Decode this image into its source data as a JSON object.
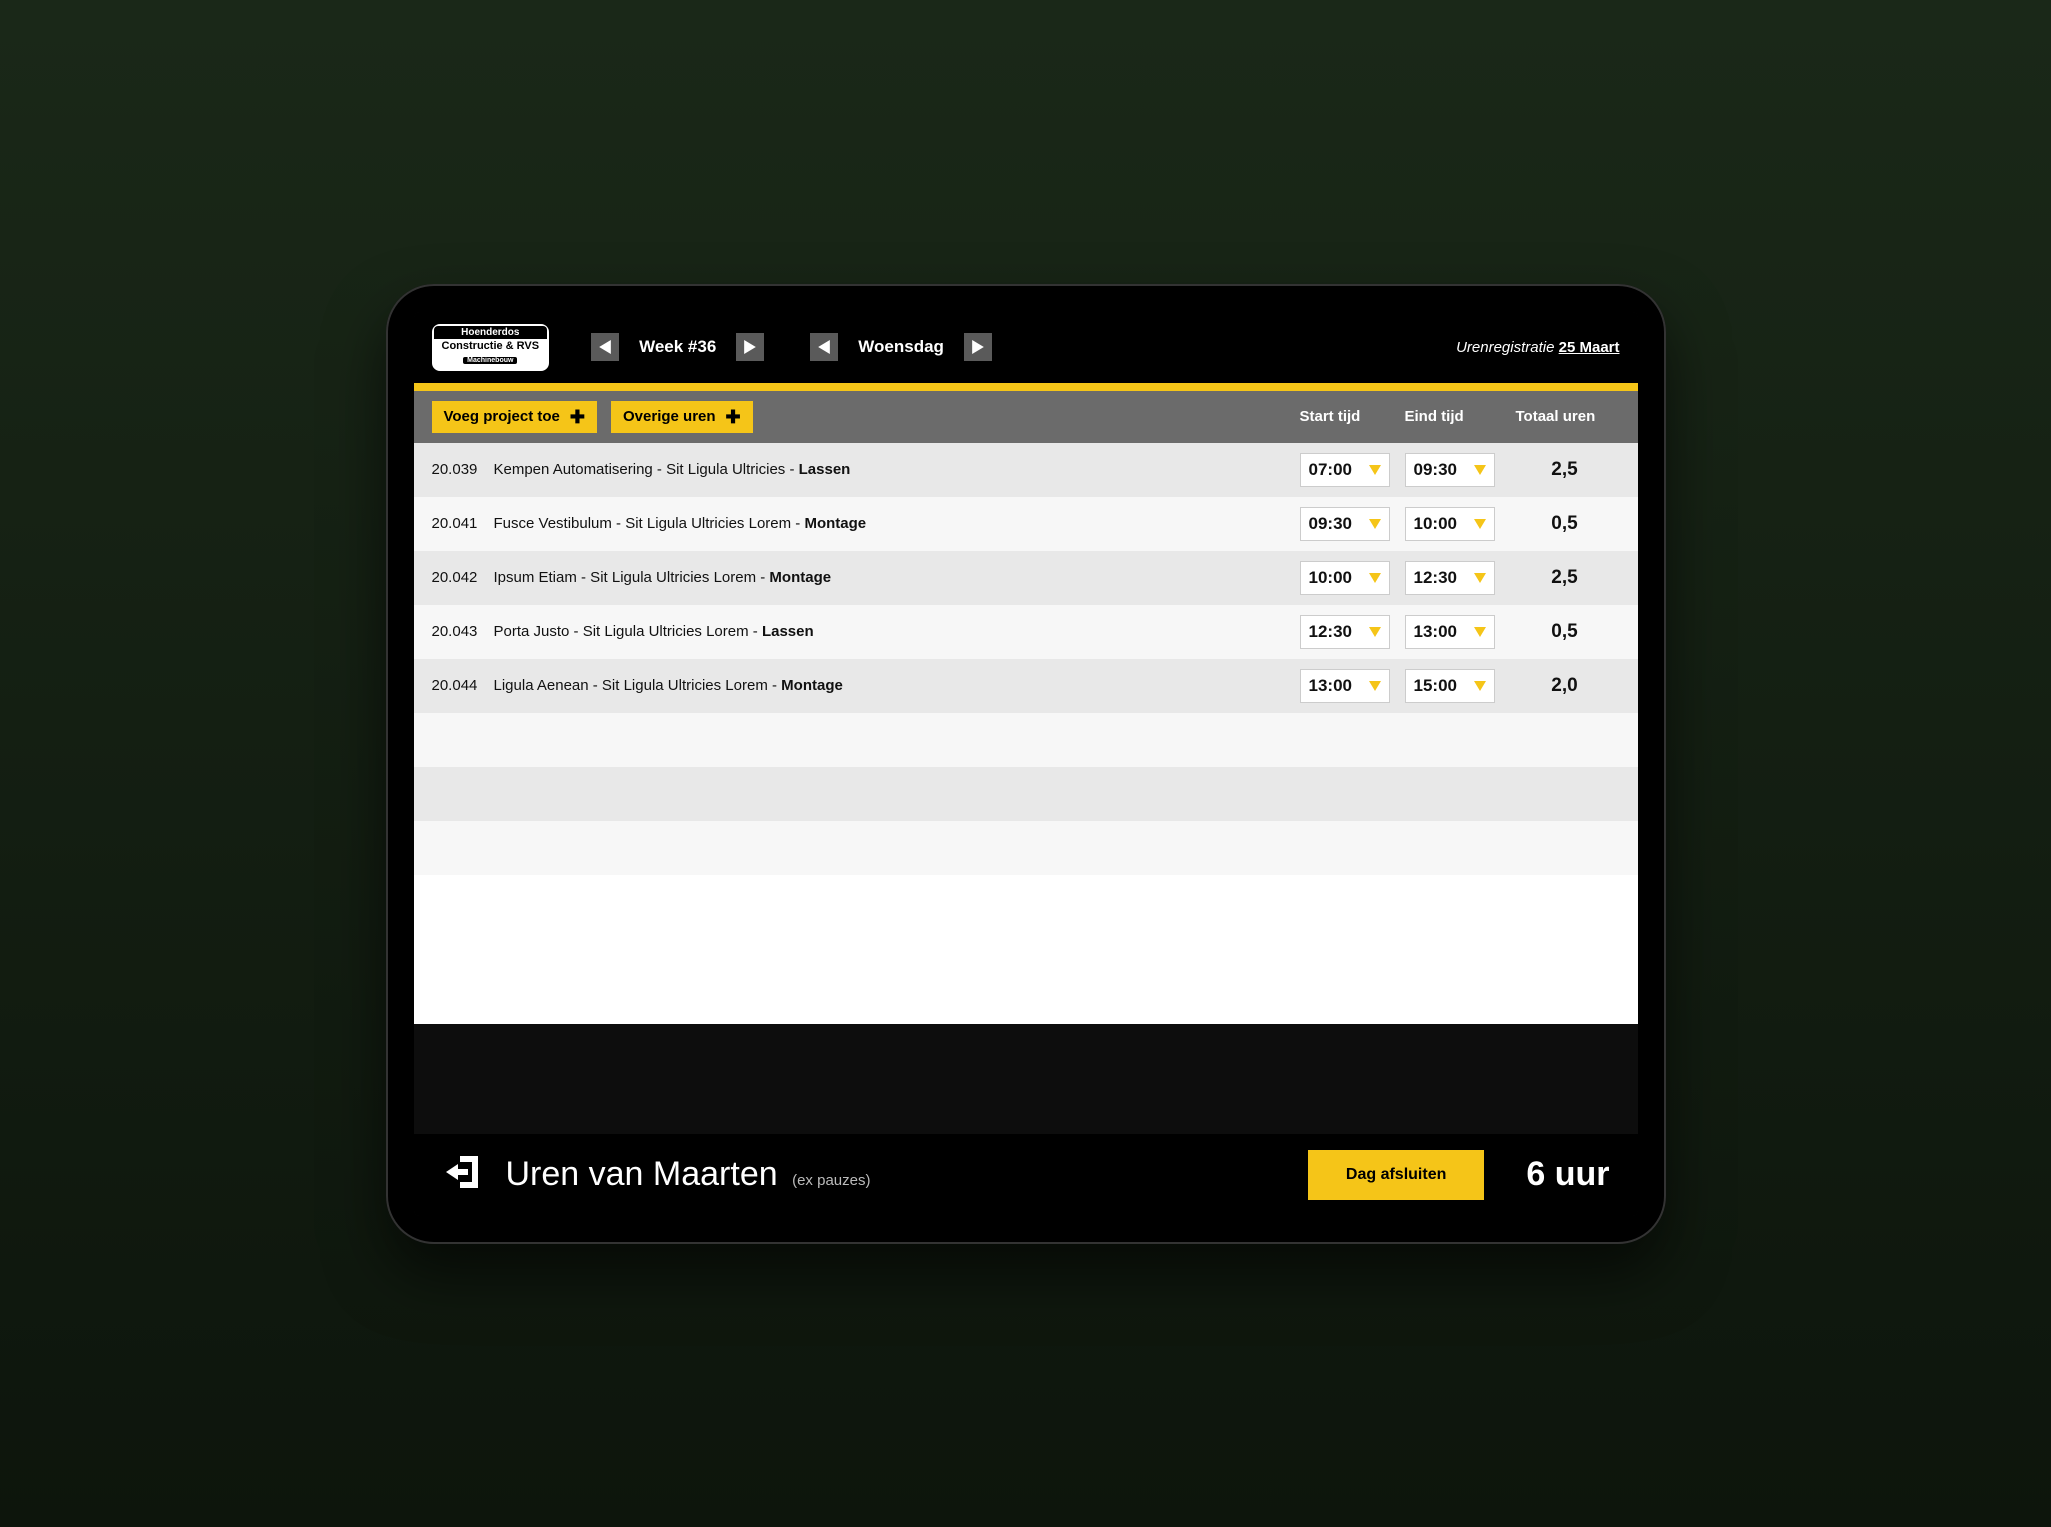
{
  "logo": {
    "line1": "Hoenderdos",
    "line2": "Constructie & RVS",
    "line3": "Machinebouw"
  },
  "header": {
    "week_label": "Week #36",
    "day_label": "Woensdag",
    "right_prefix": "Urenregistratie ",
    "right_date": "25 Maart"
  },
  "toolbar": {
    "add_project": "Voeg project toe",
    "other_hours": "Overige uren",
    "col_start": "Start tijd",
    "col_end": "Eind tijd",
    "col_total": "Totaal uren"
  },
  "rows": [
    {
      "code": "20.039",
      "client": "Kempen Automatisering",
      "desc": "Sit Ligula Ultricies ",
      "task": "Lassen",
      "start": "07:00",
      "end": "09:30",
      "total": "2,5"
    },
    {
      "code": "20.041",
      "client": "Fusce Vestibulum",
      "desc": "Sit Ligula Ultricies Lorem",
      "task": "Montage",
      "start": "09:30",
      "end": "10:00",
      "total": "0,5"
    },
    {
      "code": "20.042",
      "client": "Ipsum Etiam",
      "desc": "Sit Ligula Ultricies Lorem",
      "task": "Montage",
      "start": "10:00",
      "end": "12:30",
      "total": "2,5"
    },
    {
      "code": "20.043",
      "client": "Porta Justo",
      "desc": "Sit Ligula Ultricies Lorem",
      "task": "Lassen",
      "start": "12:30",
      "end": "13:00",
      "total": "0,5"
    },
    {
      "code": "20.044",
      "client": "Ligula Aenean",
      "desc": "Sit Ligula Ultricies Lorem",
      "task": "Montage",
      "start": "13:00",
      "end": "15:00",
      "total": "2,0"
    }
  ],
  "footer": {
    "title": "Uren van Maarten",
    "subtitle": "(ex pauzes)",
    "close_day": "Dag afsluiten",
    "total": "6 uur"
  }
}
